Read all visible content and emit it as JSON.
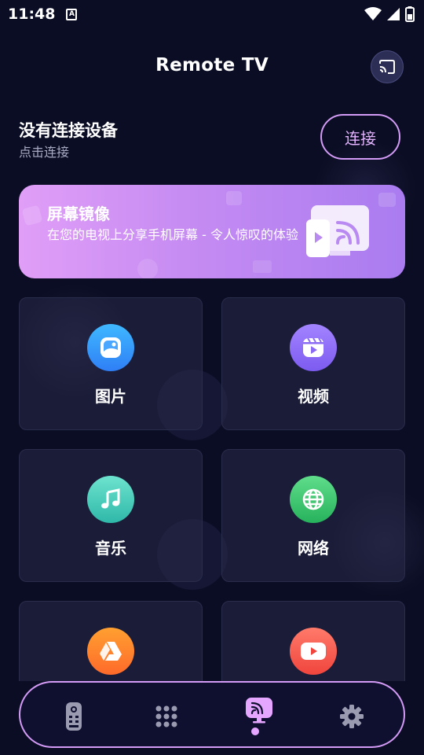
{
  "status_bar": {
    "time": "11:48",
    "notification_glyph": "A"
  },
  "header": {
    "title": "Remote TV",
    "cast_icon": "cast-icon"
  },
  "connection": {
    "title": "没有连接设备",
    "subtitle": "点击连接",
    "connect_label": "连接"
  },
  "mirror_banner": {
    "title": "屏幕镜像",
    "description": "在您的电视上分享手机屏幕 - 令人惊叹的体验",
    "gradient": [
      "#e09ef7",
      "#a97cf0"
    ]
  },
  "cards": [
    {
      "label": "图片",
      "icon": "photo-icon",
      "color_top": "#3fb8ff",
      "color_bottom": "#2f7ff5"
    },
    {
      "label": "视频",
      "icon": "video-icon",
      "color_top": "#a384ff",
      "color_bottom": "#7c5bf0"
    },
    {
      "label": "音乐",
      "icon": "music-icon",
      "color_top": "#6de3cf",
      "color_bottom": "#2fb8a8"
    },
    {
      "label": "网络",
      "icon": "globe-icon",
      "color_top": "#5fdd8a",
      "color_bottom": "#27b25c"
    },
    {
      "label": "",
      "icon": "drive-icon",
      "color_top": "#ffa030",
      "color_bottom": "#ff6a2a"
    },
    {
      "label": "",
      "icon": "youtube-icon",
      "color_top": "#ff7a6a",
      "color_bottom": "#f0453d"
    }
  ],
  "bottom_nav": {
    "items": [
      "remote-icon",
      "keypad-icon",
      "screen-mirror-icon",
      "settings-icon"
    ],
    "active_index": 2,
    "accent": "#d39bf5"
  }
}
